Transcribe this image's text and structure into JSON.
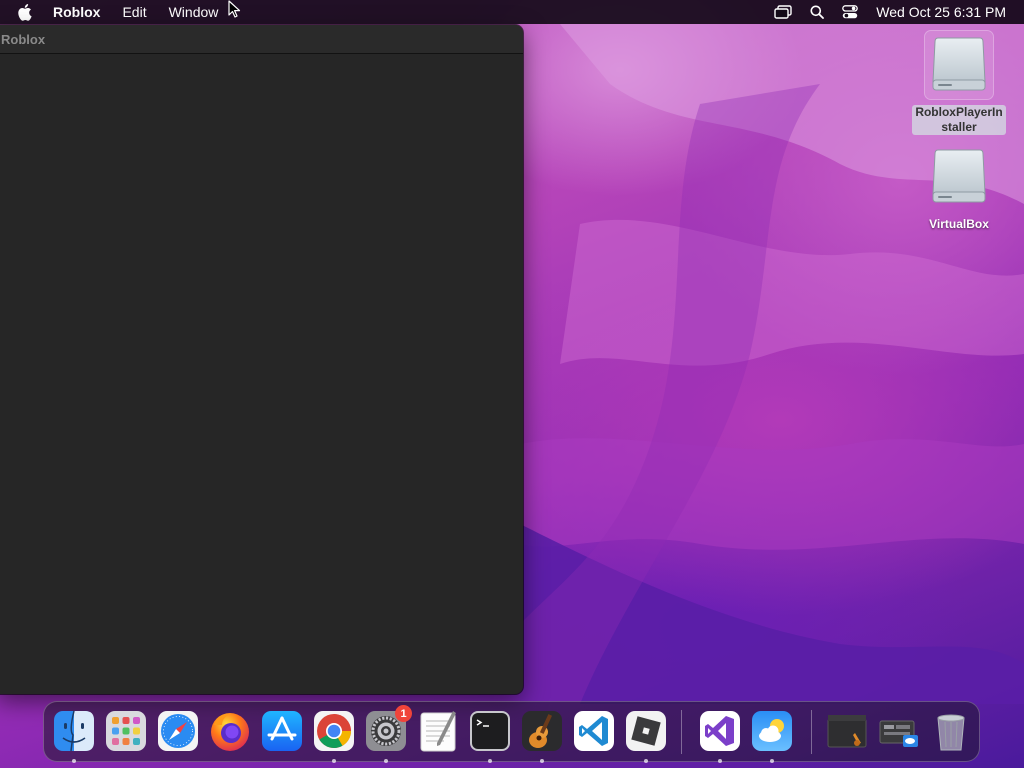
{
  "menubar": {
    "apple_icon": "apple-icon",
    "app_name": "Roblox",
    "items": [
      "Edit",
      "Window"
    ],
    "status_icons": [
      "screen-mirroring-icon",
      "spotlight-search-icon",
      "control-center-icon"
    ],
    "clock": "Wed Oct 25  6:31 PM"
  },
  "window": {
    "title": "Roblox"
  },
  "desktop": {
    "icons": [
      {
        "label": "RobloxPlayerInstaller",
        "icon": "disk-image-icon",
        "selected": true
      },
      {
        "label": "VirtualBox",
        "icon": "disk-image-icon",
        "selected": false
      }
    ]
  },
  "dock": {
    "items": [
      {
        "name": "Finder",
        "icon": "finder-icon",
        "running": true
      },
      {
        "name": "Launchpad",
        "icon": "launchpad-icon",
        "running": false
      },
      {
        "name": "Safari",
        "icon": "safari-icon",
        "running": false
      },
      {
        "name": "Firefox",
        "icon": "firefox-icon",
        "running": false
      },
      {
        "name": "App Store",
        "icon": "app-store-icon",
        "running": false
      },
      {
        "name": "Google Chrome",
        "icon": "chrome-icon",
        "running": true
      },
      {
        "name": "System Settings",
        "icon": "system-settings-icon",
        "running": true,
        "badge": "1"
      },
      {
        "name": "TextEdit",
        "icon": "textedit-icon",
        "running": false
      },
      {
        "name": "Terminal",
        "icon": "terminal-icon",
        "running": true
      },
      {
        "name": "GarageBand",
        "icon": "garageband-icon",
        "running": true
      },
      {
        "name": "Visual Studio Code",
        "icon": "vscode-icon",
        "running": false
      },
      {
        "name": "Roblox",
        "icon": "roblox-icon",
        "running": true
      },
      {
        "name": "Visual Studio",
        "icon": "visual-studio-icon",
        "running": true
      },
      {
        "name": "Weather",
        "icon": "weather-icon",
        "running": true
      },
      {
        "name": "Roblox Studio folder",
        "icon": "folder-stack-icon",
        "running": false
      },
      {
        "name": "Downloads",
        "icon": "downloads-stack-icon",
        "running": false
      },
      {
        "name": "Trash",
        "icon": "trash-icon",
        "running": false
      }
    ]
  },
  "colors": {
    "menubar_bg": "#140a18",
    "window_bg": "#262626",
    "wallpaper_accent": "#b544b9",
    "badge_red": "#f0443a"
  }
}
